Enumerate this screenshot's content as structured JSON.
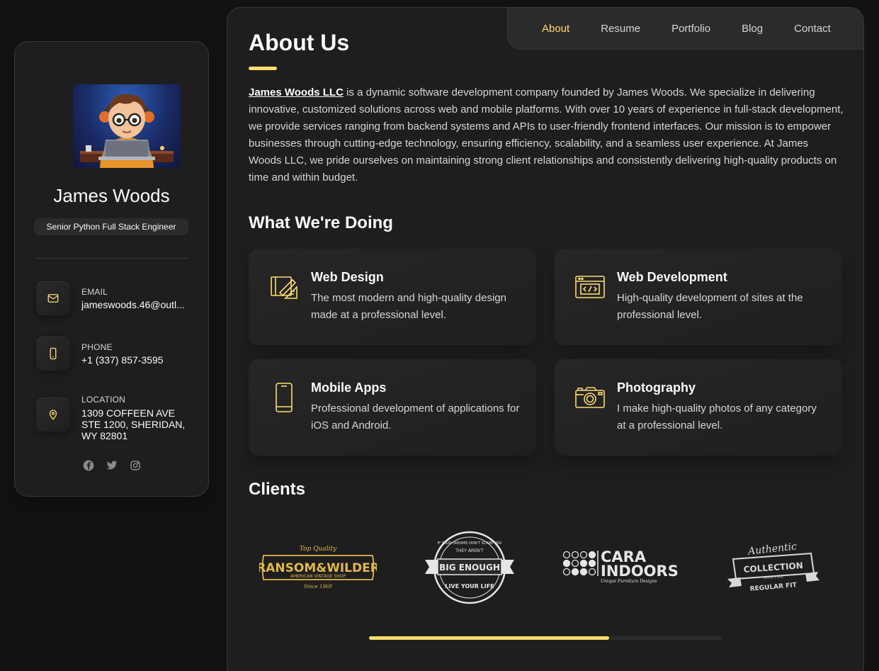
{
  "profile": {
    "name": "James Woods",
    "title": "Senior Python Full Stack Engineer"
  },
  "contacts": [
    {
      "label": "Email",
      "value": "jameswoods.46@outl...",
      "icon": "mail-icon"
    },
    {
      "label": "Phone",
      "value": "+1 (337) 857-3595",
      "icon": "phone-icon"
    },
    {
      "label": "Location",
      "value": "1309 COFFEEN AVE STE 1200, SHERIDAN, WY 82801",
      "icon": "map-pin-icon"
    }
  ],
  "socials": [
    "facebook-icon",
    "twitter-icon",
    "instagram-icon"
  ],
  "nav": {
    "items": [
      "About",
      "Resume",
      "Portfolio",
      "Blog",
      "Contact"
    ],
    "active": "About"
  },
  "about": {
    "heading": "About Us",
    "company": "James Woods LLC",
    "text": " is a dynamic software development company founded by James Woods. We specialize in delivering innovative, customized solutions across web and mobile platforms. With over 10 years of experience in full-stack development, we provide services ranging from backend systems and APIs to user-friendly frontend interfaces. Our mission is to empower businesses through cutting-edge technology, ensuring efficiency, scalability, and a seamless user experience. At James Woods LLC, we pride ourselves on maintaining strong client relationships and consistently delivering high-quality products on time and within budget."
  },
  "services_heading": "What We're Doing",
  "services": [
    {
      "title": "Web Design",
      "text": "The most modern and high-quality design made at a professional level.",
      "icon": "design-icon"
    },
    {
      "title": "Web Development",
      "text": "High-quality development of sites at the professional level.",
      "icon": "code-window-icon"
    },
    {
      "title": "Mobile Apps",
      "text": "Professional development of applications for iOS and Android.",
      "icon": "smartphone-icon"
    },
    {
      "title": "Photography",
      "text": "I make high-quality photos of any category at a professional level.",
      "icon": "camera-icon"
    }
  ],
  "clients_heading": "Clients",
  "clients": [
    {
      "name": "RANSOM&WILDER",
      "top": "Top Quality",
      "sub": "AMERICAN VINTAGE SHOP",
      "bottom": "Since 1969"
    },
    {
      "name": "BIG ENOUGH",
      "top": "THEY AREN'T",
      "sub": "LIVE YOUR LIFE",
      "ring": "IF YOUR DREAMS DON'T SCARE YOU"
    },
    {
      "name1": "CARA",
      "name2": "INDOORS",
      "sub": "Unique Furniture Designs"
    },
    {
      "name": "COLLECTION",
      "top": "Authentic",
      "sub": "REGULAR FIT",
      "small": "Since 1932"
    }
  ],
  "scroll": {
    "progress": 0.68
  },
  "colors": {
    "accent": "#ffdb70",
    "bg": "#121212",
    "panel": "#1e1e1f"
  }
}
